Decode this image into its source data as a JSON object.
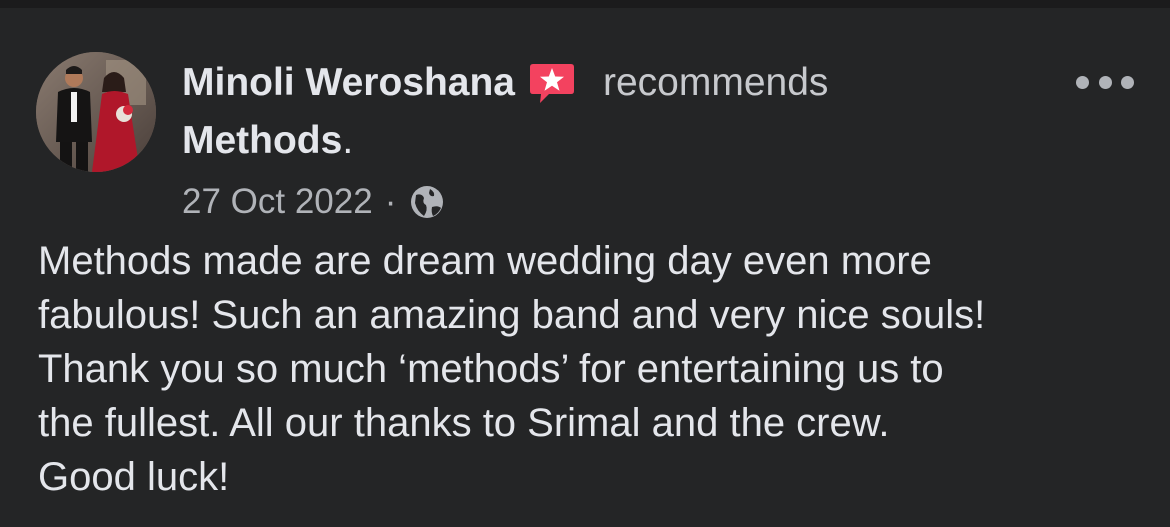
{
  "post": {
    "author_name": "Minoli Weroshana",
    "recommends_word": "recommends",
    "page_name": "Methods",
    "page_period": ".",
    "date": "27 Oct 2022",
    "separator": "·",
    "privacy_icon": "globe-icon",
    "more_icon": "more-horizontal-icon",
    "badge_icon": "recommendation-star-icon",
    "body_lines": [
      "Methods made are dream wedding day even more",
      "fabulous! Such an amazing band and very nice souls!",
      "Thank you so much ‘methods’ for entertaining us to",
      "the fullest. All our thanks to Srimal and the crew.",
      "Good luck!"
    ]
  },
  "colors": {
    "background": "#242526",
    "primary_text": "#e4e6eb",
    "secondary_text": "#b0b3b8",
    "badge_red": "#f3425f"
  }
}
